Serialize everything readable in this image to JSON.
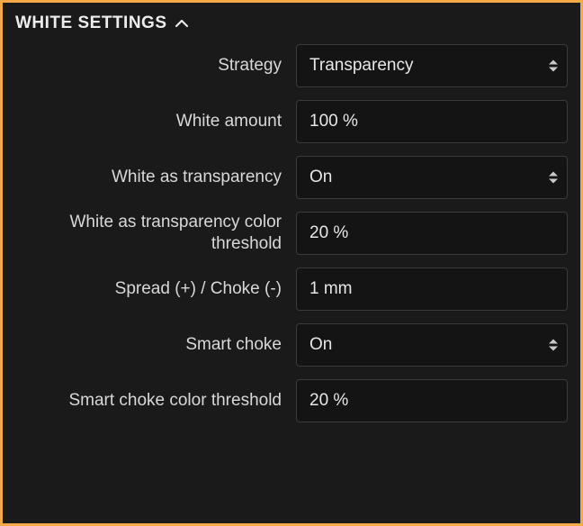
{
  "header": {
    "title": "WHITE SETTINGS"
  },
  "settings": {
    "strategy": {
      "label": "Strategy",
      "value": "Transparency"
    },
    "white_amount": {
      "label": "White amount",
      "value": "100 %"
    },
    "white_as_transparency": {
      "label": "White as transparency",
      "value": "On"
    },
    "white_as_transparency_threshold": {
      "label": "White as transparency color threshold",
      "value": "20 %"
    },
    "spread_choke": {
      "label": "Spread (+) / Choke (-)",
      "value": "1 mm"
    },
    "smart_choke": {
      "label": "Smart choke",
      "value": "On"
    },
    "smart_choke_threshold": {
      "label": "Smart choke color threshold",
      "value": "20 %"
    }
  },
  "colors": {
    "border": "#f4a847",
    "background": "#1a1a1a",
    "input_bg": "#141414",
    "text": "#e7e7e7"
  }
}
